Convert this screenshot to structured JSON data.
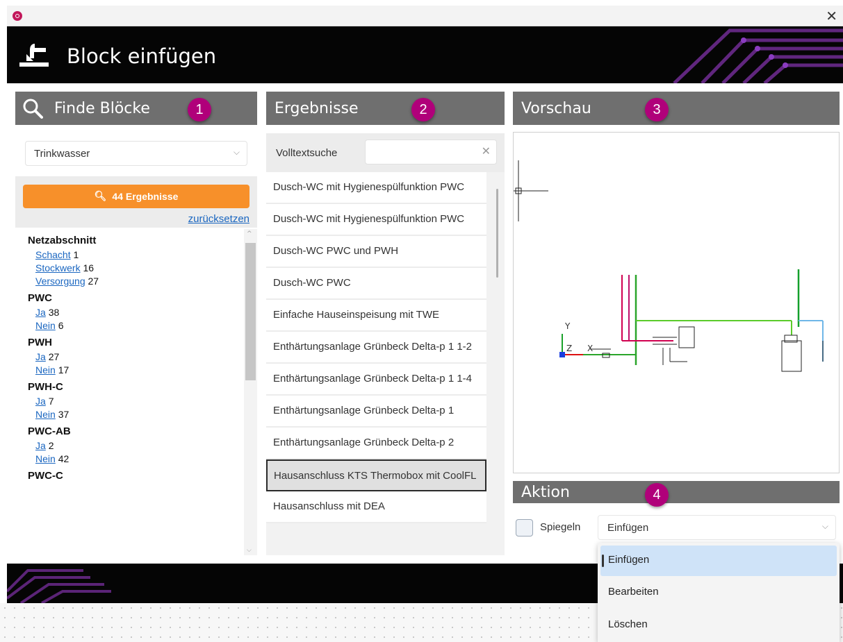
{
  "window": {
    "close_glyph": "✕"
  },
  "banner": {
    "title": "Block einfügen",
    "icon": "insert-block-icon"
  },
  "panels": {
    "find": {
      "title": "Finde Blöcke",
      "badge": "1",
      "icon": "search-icon"
    },
    "results": {
      "title": "Ergebnisse",
      "badge": "2"
    },
    "preview": {
      "title": "Vorschau",
      "badge": "3"
    },
    "action": {
      "title": "Aktion",
      "badge": "4"
    }
  },
  "filter": {
    "selected": "Trinkwasser",
    "search_button": "44 Ergebnisse",
    "reset": "zurücksetzen"
  },
  "facets": [
    {
      "title": "Netzabschnitt",
      "rows": [
        {
          "label": "Schacht",
          "count": "1"
        },
        {
          "label": "Stockwerk",
          "count": "16"
        },
        {
          "label": "Versorgung",
          "count": "27"
        }
      ]
    },
    {
      "title": "PWC",
      "rows": [
        {
          "label": "Ja",
          "count": "38"
        },
        {
          "label": "Nein",
          "count": "6"
        }
      ]
    },
    {
      "title": "PWH",
      "rows": [
        {
          "label": "Ja",
          "count": "27"
        },
        {
          "label": "Nein",
          "count": "17"
        }
      ]
    },
    {
      "title": "PWH-C",
      "rows": [
        {
          "label": "Ja",
          "count": "7"
        },
        {
          "label": "Nein",
          "count": "37"
        }
      ]
    },
    {
      "title": "PWC-AB",
      "rows": [
        {
          "label": "Ja",
          "count": "2"
        },
        {
          "label": "Nein",
          "count": "42"
        }
      ]
    },
    {
      "title": "PWC-C",
      "rows": []
    }
  ],
  "search": {
    "label": "Volltextsuche",
    "value": "",
    "clear": "✕"
  },
  "results": [
    "Dusch-WC mit Hygienespülfunktion PWC",
    "Dusch-WC mit Hygienespülfunktion PWC",
    "Dusch-WC PWC und PWH",
    "Dusch-WC PWC",
    "Einfache Hauseinspeisung mit TWE",
    "Enthärtungsanlage Grünbeck Delta-p 1 1-2",
    "Enthärtungsanlage Grünbeck Delta-p 1 1-4",
    "Enthärtungsanlage Grünbeck Delta-p 1",
    "Enthärtungsanlage Grünbeck Delta-p 2",
    "Hausanschluss KTS Thermobox mit CoolFL",
    "Hausanschluss mit DEA"
  ],
  "selected_result_index": 9,
  "preview": {
    "axis_y": "Y",
    "axis_z": "Z",
    "axis_x": "X"
  },
  "action": {
    "mirror_label": "Spiegeln",
    "mirror_checked": false,
    "mode_selected": "Einfügen",
    "options": [
      "Einfügen",
      "Bearbeiten",
      "Löschen"
    ]
  }
}
